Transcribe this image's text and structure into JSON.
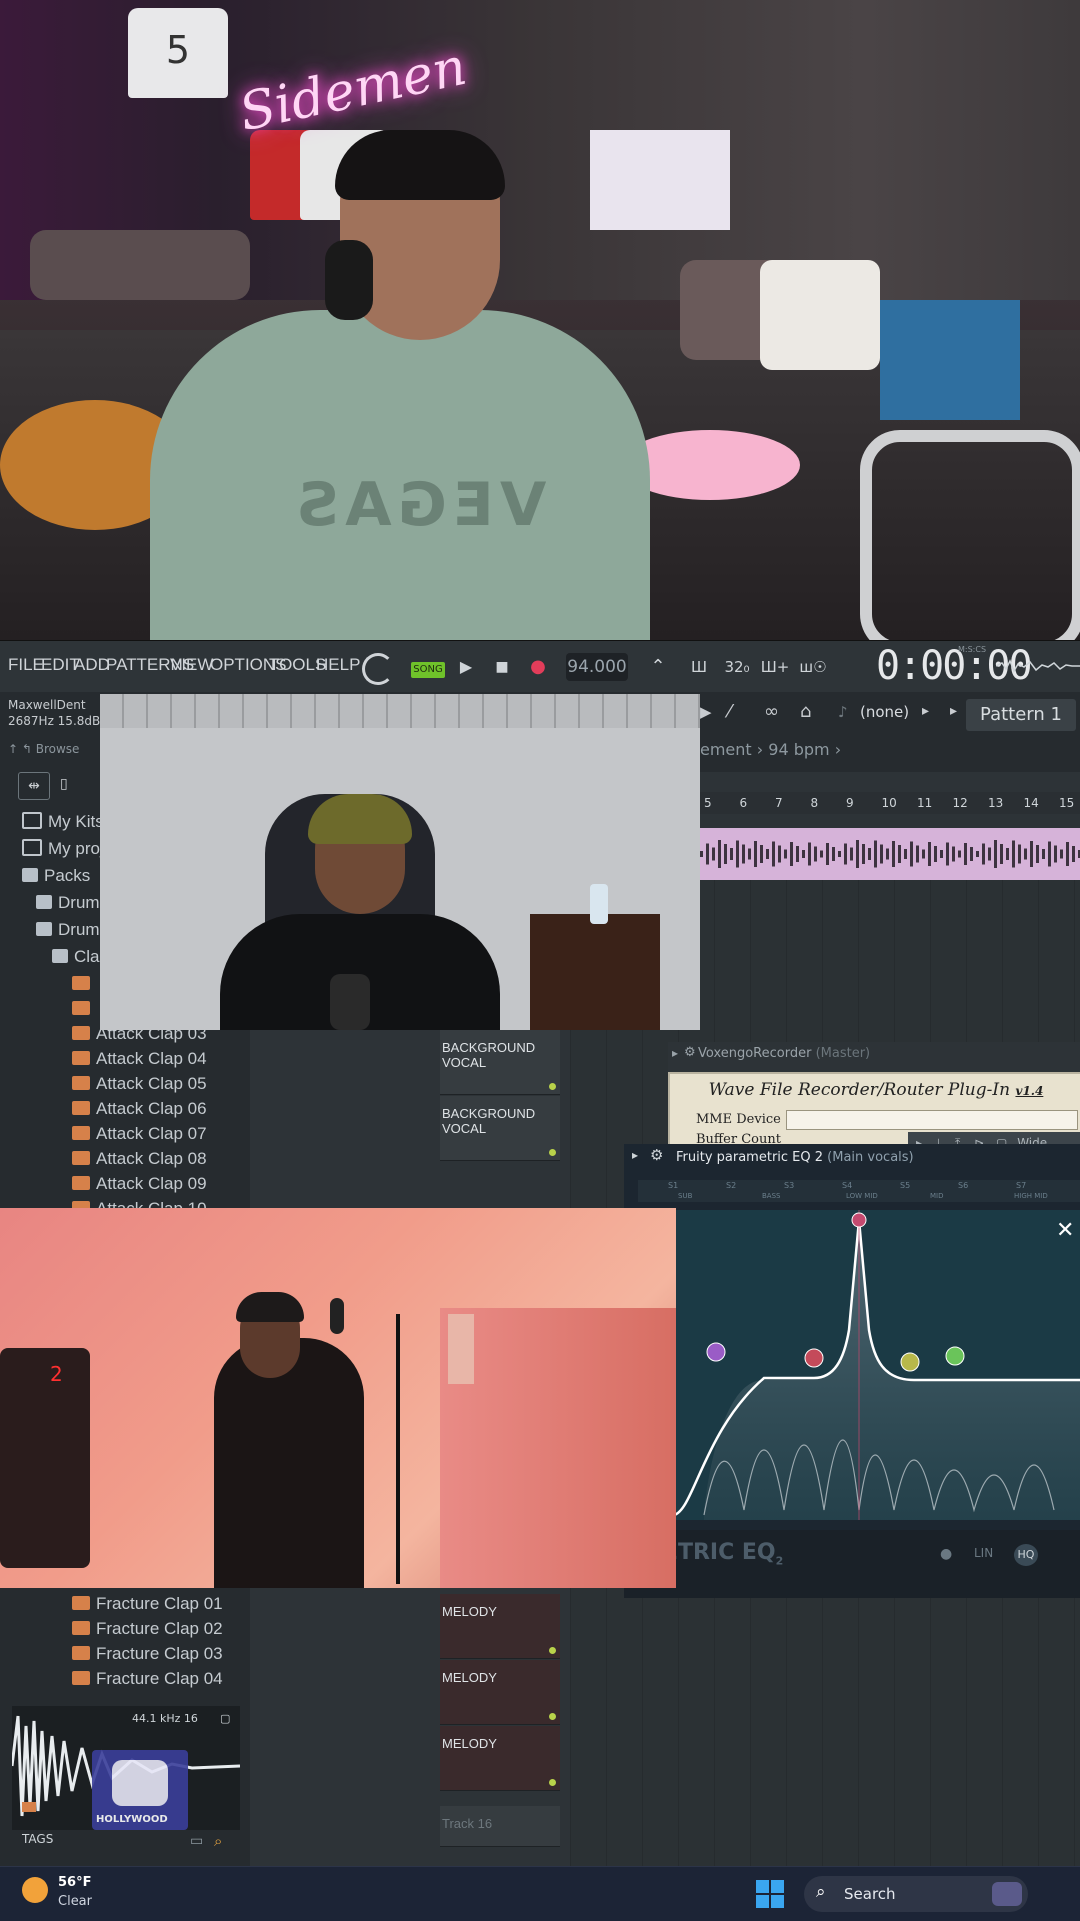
{
  "menubar": {
    "items": [
      "FILE",
      "EDIT",
      "ADD",
      "PATTERNS",
      "VIEW",
      "OPTIONS",
      "TOOLS",
      "HELP"
    ],
    "song_label": "SONG",
    "bpm": "94.000",
    "tool_labels": [
      "32₀",
      "Ш+",
      "ш☉"
    ],
    "time": "0:00:00",
    "time_unit": "M:S:CS"
  },
  "strip": {
    "plugin_name": "MaxwellDent",
    "hint_info": "2687Hz 15.8dB",
    "browse_label": "Browse",
    "arrangement": "ement › 94 bpm ›",
    "none_label": "(none)",
    "pattern": "Pattern 1"
  },
  "browser": {
    "top_items": [
      {
        "label": "My Kits",
        "icon": "folder-icon"
      },
      {
        "label": "My proj",
        "icon": "folder-icon"
      },
      {
        "label": "Packs",
        "icon": "pack-icon"
      },
      {
        "label": "Drum",
        "icon": "pack-icon"
      },
      {
        "label": "Drum",
        "icon": "pack-icon"
      },
      {
        "label": "Cla",
        "icon": "pack-icon"
      }
    ],
    "attack_claps": [
      "Attack Clap 03",
      "Attack Clap 04",
      "Attack Clap 05",
      "Attack Clap 06",
      "Attack Clap 07",
      "Attack Clap 08",
      "Attack Clap 09",
      "Attack Clap 10"
    ],
    "fracture_claps": [
      "Fracture Clap 01",
      "Fracture Clap 02",
      "Fracture Clap 03",
      "Fracture Clap 04"
    ],
    "preview_info": "44.1 kHz 16",
    "tags_label": "TAGS"
  },
  "playlist": {
    "ruler": [
      "5",
      "6",
      "7",
      "8",
      "9",
      "10",
      "11",
      "12",
      "13",
      "14",
      "15"
    ],
    "tracks": [
      {
        "name": "BACKGROUND VOCAL",
        "kind": "bg"
      },
      {
        "name": "BACKGROUND VOCAL",
        "kind": "bg"
      },
      {
        "name": "MELODY",
        "kind": "melody"
      },
      {
        "name": "MELODY",
        "kind": "melody"
      },
      {
        "name": "MELODY",
        "kind": "melody"
      },
      {
        "name": "Track 16",
        "kind": "empty"
      }
    ]
  },
  "voxengo": {
    "title": "VoxengoRecorder",
    "title_suffix": "(Master)",
    "heading": "Wave File Recorder/Router Plug-In",
    "version": "v1.4",
    "mme_label": "MME Device",
    "buffer_label": "Buffer Count",
    "wide_label": "Wide"
  },
  "eq": {
    "title": "Fruity parametric EQ 2",
    "target": "(Main vocals)",
    "bands": [
      "S1",
      "S2",
      "S3",
      "S4",
      "S5",
      "S6",
      "S7"
    ],
    "band_names": [
      "SUB",
      "BASS",
      "LOW MID",
      "MID",
      "HIGH MID"
    ],
    "watermark": "AMETRIC EQ",
    "watermark_sub": "2",
    "lin_label": "LIN",
    "hq_label": "HQ"
  },
  "taskbar": {
    "temperature": "56°F",
    "weather": "Clear",
    "search": "Search"
  },
  "camera_top": {
    "neon_sign": "Sidemen",
    "shirt_text": "VEGAS",
    "jersey_number": "5"
  },
  "studio_cam": {
    "keypad_digit": "2"
  },
  "logo": {
    "text": "HOLLYWOOD"
  },
  "colors": {
    "accent_green": "#6fc22a",
    "record_red": "#e23d5a",
    "clip_pink": "#d6b3d9",
    "eq_curve": "#ffffff",
    "taskbar": "#1c2436"
  }
}
